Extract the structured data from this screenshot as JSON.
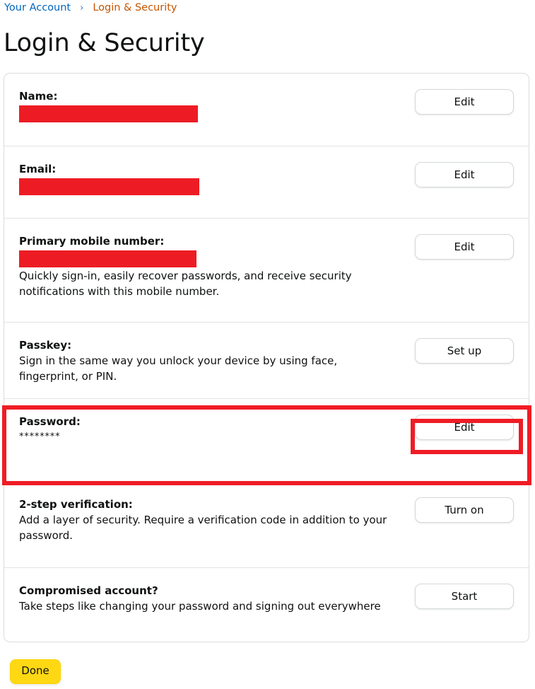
{
  "breadcrumb": {
    "parent_label": "Your Account",
    "separator": "›",
    "current_label": "Login & Security"
  },
  "page": {
    "title": "Login & Security"
  },
  "rows": [
    {
      "key": "name",
      "label": "Name:",
      "value_redacted": true,
      "description": "",
      "button_label": "Edit"
    },
    {
      "key": "email",
      "label": "Email:",
      "value_redacted": true,
      "description": "",
      "button_label": "Edit"
    },
    {
      "key": "mobile",
      "label": "Primary mobile number:",
      "value_redacted": true,
      "description": "Quickly sign-in, easily recover passwords, and receive security notifications with this mobile number.",
      "button_label": "Edit"
    },
    {
      "key": "passkey",
      "label": "Passkey:",
      "value_redacted": false,
      "description": "Sign in the same way you unlock your device by using face, fingerprint, or PIN.",
      "button_label": "Set up"
    },
    {
      "key": "password",
      "label": "Password:",
      "value_redacted": false,
      "masked_value": "********",
      "description": "",
      "button_label": "Edit"
    },
    {
      "key": "twostep",
      "label": "2-step verification:",
      "value_redacted": false,
      "description": "Add a layer of security. Require a verification code in addition to your password.",
      "button_label": "Turn on"
    },
    {
      "key": "compromised",
      "label": "Compromised account?",
      "value_redacted": false,
      "description": "Take steps like changing your password and signing out everywhere",
      "button_label": "Start"
    }
  ],
  "footer": {
    "done_label": "Done"
  },
  "colors": {
    "redaction": "#ed1c24",
    "annotation_highlight": "#ef1c25",
    "breadcrumb_link": "#0066c0",
    "breadcrumb_current": "#c45500",
    "primary_button": "#ffd814",
    "card_border": "#dcdcdc"
  }
}
